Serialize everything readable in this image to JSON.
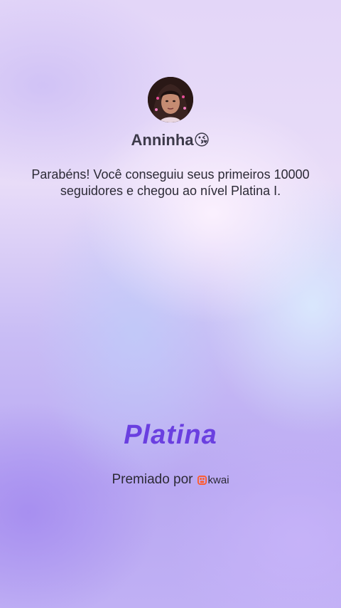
{
  "profile": {
    "name": "Anninha😘"
  },
  "message": "Parabéns! Você conseguiu seus primeiros 10000 seguidores e chegou ao nível Platina I.",
  "level": "Platina",
  "awarded": {
    "prefix": "Premiado por",
    "brand": "kwai",
    "brand_color": "#ff5a2a"
  },
  "colors": {
    "level_text": "#6a3fe0"
  }
}
